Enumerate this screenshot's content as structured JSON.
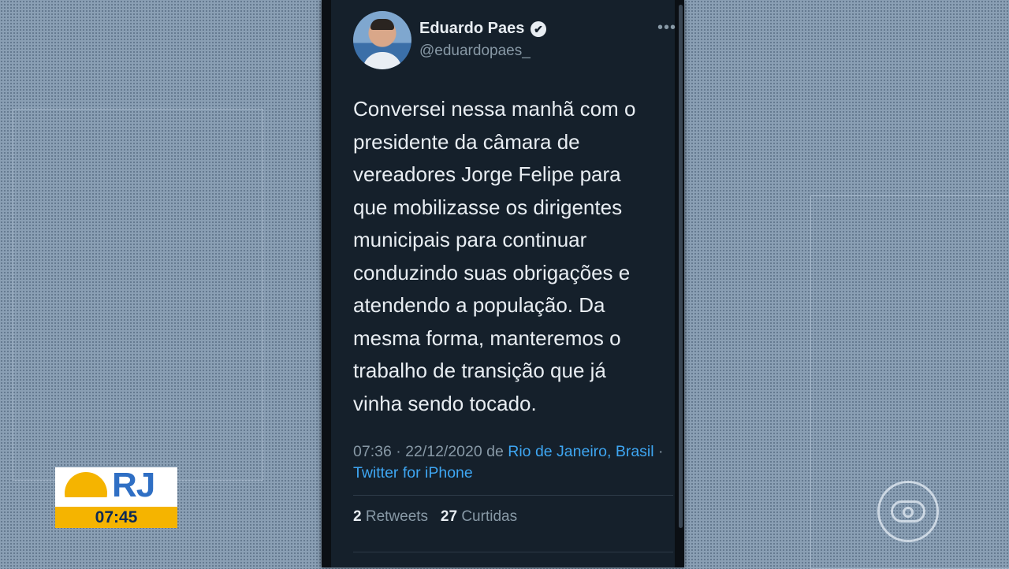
{
  "tweet": {
    "author_name": "Eduardo Paes",
    "author_handle": "@eduardopaes_",
    "verified_icon": "✔",
    "more_icon": "•••",
    "text_lines": [
      "Conversei nessa manhã com o",
      "presidente da câmara de",
      "vereadores Jorge Felipe para",
      "que mobilizasse os dirigentes",
      "municipais para continuar",
      "conduzindo suas obrigações e",
      "atendendo a população. Da",
      "mesma forma, manteremos o",
      "trabalho de transição que já",
      "vinha sendo tocado."
    ],
    "time": "07:36 · 22/12/2020 de",
    "location": "Rio de Janeiro, Brasil",
    "separator": "·",
    "source": "Twitter for iPhone",
    "retweets_count": "2",
    "retweets_label": "Retweets",
    "likes_count": "27",
    "likes_label": "Curtidas"
  },
  "overlay": {
    "logo_text": "RJ",
    "clock": "07:45"
  },
  "colors": {
    "background": "#8a9fb4",
    "tweet_bg": "#15202b",
    "link": "#3ea6f2",
    "logo_yellow": "#f5b400",
    "logo_blue": "#2f6fc4"
  }
}
